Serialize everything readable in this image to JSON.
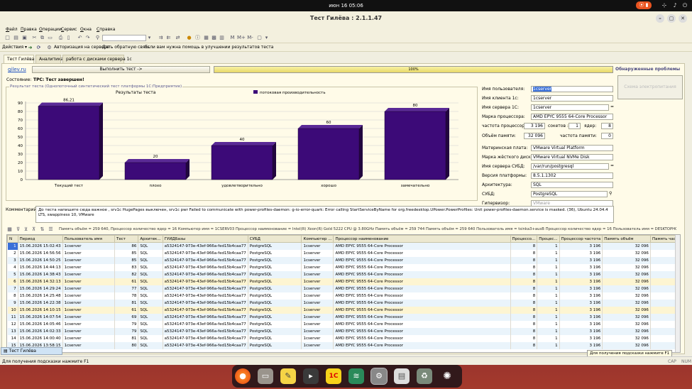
{
  "topbar": {
    "clock": "июн 16  05:06"
  },
  "window": {
    "title": "Тест Гилёва : 2.1.1.47"
  },
  "menu": [
    "Файл",
    "Правка",
    "Операции",
    "Сервис",
    "Окна",
    "Справка"
  ],
  "toolbar2": {
    "actions": "Действия ▾",
    "auth": "Авторизация на сервере",
    "feedback": "Дать обратную связь",
    "help": "Если вам нужна помощь в улучшении результатов теста"
  },
  "tabs": [
    "Тест Гилёва",
    "Аналитика",
    "работа с дисками сервера 1с"
  ],
  "link": "gilev.ru",
  "run_button": "Выполнить тест ->",
  "progress": {
    "value": 100,
    "label": "100%"
  },
  "problems": {
    "title": "Обнаруженные проблемы",
    "button": "Схема электропитания"
  },
  "state": {
    "label": "Состояние:",
    "value": "TPC: Тест завершен!"
  },
  "result_group": "Результат теста (Однопоточный синтетический тест платформы 1С:Предприятие)",
  "chart_data": {
    "type": "bar",
    "title": "Результаты теста",
    "legend": "потоковая производительность",
    "categories": [
      "Текущий тест",
      "плохо",
      "удовлетворительно",
      "хорошо",
      "замечательно"
    ],
    "values": [
      86.21,
      20,
      40,
      60,
      80
    ],
    "value_labels": [
      "86,21",
      "20",
      "40",
      "60",
      "80"
    ],
    "ylim": [
      0,
      90
    ],
    "yticks": [
      0,
      10,
      20,
      30,
      40,
      50,
      60,
      70,
      80,
      90
    ],
    "color": "#3c0a78"
  },
  "info": {
    "user_label": "Имя пользователя:",
    "user": "1cserver",
    "client_label": "Имя клиента 1с:",
    "client": "1cserver",
    "server_label": "Имя сервера 1С:",
    "server": "1cserver",
    "cpu_label": "Марка процессора:",
    "cpu": "AMD EPYC 9555 64-Core Processor",
    "freq_label": "частота процессора:",
    "freq": "3 196",
    "sockets_label": "сокетов :",
    "sockets": "1",
    "cores_label": "ядер:",
    "cores": "8",
    "mem_label": "Объём памяти:",
    "mem": "32 096",
    "memfreq_label": "частота памяти:",
    "memfreq": "0",
    "mb_label": "Материнская плата:",
    "mb": "VMware Virtual Platform",
    "disk_label": "Марка жёсткого диска:",
    "disk": "VMware Virtual NVMe Disk",
    "dbsrv_label": "Имя сервера СУБД:",
    "dbsrv": "/var/run/postgresql",
    "platform_label": "Версия платформы:",
    "platform": "8.5.1.1302",
    "arch_label": "Архитектура:",
    "arch": "SQL",
    "dbms_label": "СУБД:",
    "dbms": "PostgreSQL",
    "hyper_label": "Гипервизор:",
    "hyper": "VMware"
  },
  "comment": {
    "label": "Комментарий:",
    "text": "До теста напишите сюда важное , srv1c HugePages выключен, srv1c pwr Failed to communicate with power-profiles-daemon: g-io-error-quark: Error calling StartServiceByName for org.freedesktop.UPower.PowerProfiles: Unit power-profiles-daemon.service is masked. (36), Ubuntu 24.04.4 LTS, swappiness 10, VMware"
  },
  "filters": "Память объём = 259 640, Процессор количество ядер = 16    Компьютер имя = 1CSERV03   Процессор наименование = Intel(R) Xeon(R) Gold 5222 CPU @ 3.80GHz   Память объём = 259 744   Память объём = 259 640   Пользователь имя = tsinka3+ausB   Процессор количество ядер = 16   Пользователь имя = DESKTOPHONOR+intel",
  "grid": {
    "columns": [
      "N",
      "Период",
      "Пользователь имя",
      "Тест",
      "Архитек...",
      "ГУИДБазы",
      "СУБД",
      "Компьютер ...",
      "Процессор наименование",
      "Процессо...",
      "Процес...",
      "Процессор частота",
      "Память объём",
      "Память част"
    ],
    "rows": [
      [
        "1",
        "15.06.2026 15:02:43",
        "1cserver",
        "86",
        "SQL",
        "a5324147-973e-43ef-966a-fed15b4caa77",
        "PostgreSQL",
        "1cserver",
        "AMD EPYC 9555 64-Core Processor",
        "8",
        "1",
        "3 196",
        "32 096",
        ""
      ],
      [
        "2",
        "15.06.2026 14:56:56",
        "1cserver",
        "85",
        "SQL",
        "a5324147-973e-43ef-966a-fed15b4caa77",
        "PostgreSQL",
        "1cserver",
        "AMD EPYC 9555 64-Core Processor",
        "8",
        "1",
        "3 196",
        "32 096",
        ""
      ],
      [
        "3",
        "15.06.2026 14:50:25",
        "1cserver",
        "85",
        "SQL",
        "a5324147-973e-43ef-966a-fed15b4caa77",
        "PostgreSQL",
        "1cserver",
        "AMD EPYC 9555 64-Core Processor",
        "8",
        "1",
        "3 196",
        "32 096",
        ""
      ],
      [
        "4",
        "15.06.2026 14:44:13",
        "1cserver",
        "83",
        "SQL",
        "a5324147-973e-43ef-966a-fed15b4caa77",
        "PostgreSQL",
        "1cserver",
        "AMD EPYC 9555 64-Core Processor",
        "8",
        "1",
        "3 196",
        "32 096",
        ""
      ],
      [
        "5",
        "15.06.2026 14:38:43",
        "1cserver",
        "82",
        "SQL",
        "a5324147-973e-43ef-966a-fed15b4caa77",
        "PostgreSQL",
        "1cserver",
        "AMD EPYC 9555 64-Core Processor",
        "8",
        "1",
        "3 196",
        "32 096",
        ""
      ],
      [
        "6",
        "15.06.2026 14:32:13",
        "1cserver",
        "61",
        "SQL",
        "a5324147-973e-43ef-966a-fed15b4caa77",
        "PostgreSQL",
        "1cserver",
        "AMD EPYC 9555 64-Core Processor",
        "8",
        "1",
        "3 196",
        "32 096",
        ""
      ],
      [
        "7",
        "15.06.2026 14:29:24",
        "1cserver",
        "77",
        "SQL",
        "a5324147-973e-43ef-966a-fed15b4caa77",
        "PostgreSQL",
        "1cserver",
        "AMD EPYC 9555 64-Core Processor",
        "8",
        "1",
        "3 196",
        "32 096",
        ""
      ],
      [
        "8",
        "15.06.2026 14:25:48",
        "1cserver",
        "78",
        "SQL",
        "a5324147-973e-43ef-966a-fed15b4caa77",
        "PostgreSQL",
        "1cserver",
        "AMD EPYC 9555 64-Core Processor",
        "8",
        "1",
        "3 196",
        "32 096",
        ""
      ],
      [
        "9",
        "15.06.2026 14:22:38",
        "1cserver",
        "81",
        "SQL",
        "a5324147-973e-43ef-966a-fed15b4caa77",
        "PostgreSQL",
        "1cserver",
        "AMD EPYC 9555 64-Core Processor",
        "8",
        "1",
        "3 196",
        "32 096",
        ""
      ],
      [
        "10",
        "15.06.2026 14:10:15",
        "1cserver",
        "61",
        "SQL",
        "a5324147-973e-43ef-966a-fed15b4caa77",
        "PostgreSQL",
        "1cserver",
        "AMD EPYC 9555 64-Core Processor",
        "8",
        "1",
        "3 196",
        "32 096",
        ""
      ],
      [
        "11",
        "15.06.2026 14:07:54",
        "1cserver",
        "69",
        "SQL",
        "a5324147-973e-43ef-966a-fed15b4caa77",
        "PostgreSQL",
        "1cserver",
        "AMD EPYC 9555 64-Core Processor",
        "8",
        "1",
        "3 196",
        "32 096",
        ""
      ],
      [
        "12",
        "15.06.2026 14:05:46",
        "1cserver",
        "79",
        "SQL",
        "a5324147-973e-43ef-966a-fed15b4caa77",
        "PostgreSQL",
        "1cserver",
        "AMD EPYC 9555 64-Core Processor",
        "8",
        "1",
        "3 196",
        "32 096",
        ""
      ],
      [
        "13",
        "15.06.2026 14:02:33",
        "1cserver",
        "79",
        "SQL",
        "a5324147-973e-43ef-966a-fed15b4caa77",
        "PostgreSQL",
        "1cserver",
        "AMD EPYC 9555 64-Core Processor",
        "8",
        "1",
        "3 196",
        "32 096",
        ""
      ],
      [
        "14",
        "15.06.2026 14:00:40",
        "1cserver",
        "81",
        "SQL",
        "a5324147-973e-43ef-966a-fed15b4caa77",
        "PostgreSQL",
        "1cserver",
        "AMD EPYC 9555 64-Core Processor",
        "8",
        "1",
        "3 196",
        "32 096",
        ""
      ],
      [
        "15",
        "15.06.2026 13:58:15",
        "1cserver",
        "80",
        "SQL",
        "a5324147-973e-43ef-966a-fed15b4caa77",
        "PostgreSQL",
        "1cserver",
        "AMD EPYC 9555 64-Core Processor",
        "8",
        "1",
        "3 196",
        "32 096",
        ""
      ]
    ]
  },
  "bottom_tab": "Тест Гилёва",
  "tooltip": "Для получения подсказки нажмите F1",
  "status": {
    "hint": "Для получения подсказки нажмите F1",
    "cap": "CAP",
    "num": "NUM"
  }
}
